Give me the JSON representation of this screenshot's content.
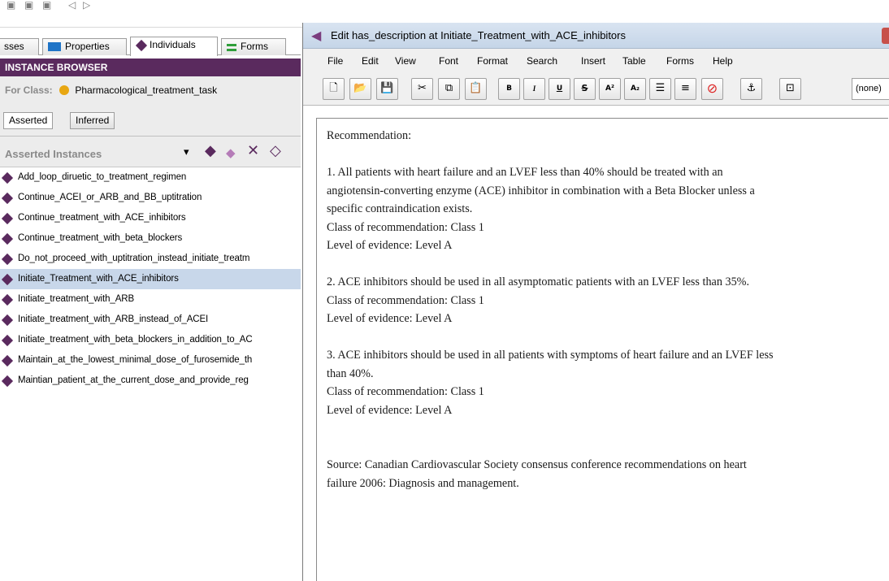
{
  "toolbar_glyphs": [
    "▣",
    "▣",
    "▣",
    "◁",
    "▷"
  ],
  "left_tabs": [
    {
      "label": "sses",
      "icon": "none"
    },
    {
      "label": "Properties",
      "icon": "blue-square-icon",
      "color": "#1f74c7"
    },
    {
      "label": "Individuals",
      "icon": "purple-diamond-icon",
      "color": "#5a2a5e"
    },
    {
      "label": "Forms",
      "icon": "green-lines-icon",
      "color": "#2f9e3a"
    }
  ],
  "instance_browser": {
    "header": "INSTANCE BROWSER",
    "for_class_label": "For Class:",
    "for_class_value": "Pharmacological_treatment_task",
    "assert_tabs": [
      "Asserted",
      "Inferred"
    ],
    "list_title": "Asserted Instances",
    "header_icons": [
      "▾",
      "◆",
      "◆",
      "✕",
      "◇"
    ]
  },
  "instances": [
    "Add_loop_diruetic_to_treatment_regimen",
    "Continue_ACEI_or_ARB_and_BB_uptitration",
    "Continue_treatment_with_ACE_inhibitors",
    "Continue_treatment_with_beta_blockers",
    "Do_not_proceed_with_uptitration_instead_initiate_treatm",
    "Initiate_Treatment_with_ACE_inhibitors",
    "Initiate_treatment_with_ARB",
    "Initiate_treatment_with_ARB_instead_of_ACEI",
    "Initiate_treatment_with_beta_blockers_in_addition_to_AC",
    "Maintain_at_the_lowest_minimal_dose_of_furosemide_th",
    "Maintian_patient_at_the_current_dose_and_provide_reg"
  ],
  "selected_instance_index": 5,
  "editor": {
    "title": "Edit has_description at Initiate_Treatment_with_ACE_inhibitors",
    "menus": [
      "File",
      "Edit",
      "View",
      "Font",
      "Format",
      "Search",
      "Insert",
      "Table",
      "Forms",
      "Help"
    ],
    "tools": [
      {
        "name": "new-document-icon",
        "glyph": "🗋"
      },
      {
        "name": "open-folder-icon",
        "glyph": "📂"
      },
      {
        "name": "save-icon",
        "glyph": "💾"
      },
      {
        "name": "cut-icon",
        "glyph": "✂"
      },
      {
        "name": "copy-icon",
        "glyph": "⧉"
      },
      {
        "name": "paste-icon",
        "glyph": "📋"
      },
      {
        "name": "bold-icon",
        "glyph": "B"
      },
      {
        "name": "italic-icon",
        "glyph": "I"
      },
      {
        "name": "underline-icon",
        "glyph": "U"
      },
      {
        "name": "strikethrough-icon",
        "glyph": "S"
      },
      {
        "name": "superscript-icon",
        "glyph": "A²"
      },
      {
        "name": "subscript-icon",
        "glyph": "A₂"
      },
      {
        "name": "bullet-list-icon",
        "glyph": "☰"
      },
      {
        "name": "numbered-list-icon",
        "glyph": "≡"
      },
      {
        "name": "clear-format-icon",
        "glyph": "⊘"
      },
      {
        "name": "anchor-icon",
        "glyph": "⚓"
      },
      {
        "name": "source-view-icon",
        "glyph": "⊡"
      }
    ],
    "style_select": "(none)",
    "paragraphs": [
      "Recommendation:",
      "",
      "1. All patients with heart failure and an LVEF less than 40% should be treated with an",
      "angiotensin-converting enzyme (ACE) inhibitor in combination with a Beta Blocker unless a",
      "specific contraindication exists.",
      "Class of recommendation: Class 1",
      "Level of evidence: Level A",
      "",
      "2. ACE inhibitors should be used in all asymptomatic patients with an LVEF less than 35%.",
      "Class of recommendation: Class 1",
      "Level of evidence: Level A",
      "",
      "3. ACE inhibitors should be used in all patients with symptoms of heart failure and an LVEF less",
      "than 40%.",
      "Class of recommendation: Class 1",
      "Level of evidence: Level A",
      "",
      "",
      "Source: Canadian Cardiovascular Society consensus conference recommendations on heart",
      "failure 2006: Diagnosis and management."
    ]
  }
}
